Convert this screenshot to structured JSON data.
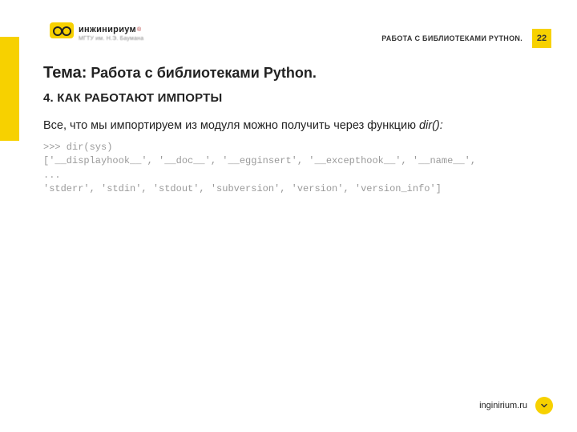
{
  "header": {
    "logo_title": "инжинириум",
    "logo_sup": "®",
    "logo_sub": "МГТУ им. Н.Э. Баумана",
    "course_title": "РАБОТА С БИБЛИОТЕКАМИ PYTHON.",
    "page_number": "22"
  },
  "topic": {
    "lead": "Тема:",
    "rest": " Работа с библиотеками Python."
  },
  "section": "4. КАК РАБОТАЮТ ИМПОРТЫ",
  "body": {
    "text_before_em": "Все, что мы импортируем из модуля можно получить через функцию ",
    "em": "dir():"
  },
  "code_lines": {
    "l1": ">>> dir(sys)",
    "l2": "['__displayhook__', '__doc__', '__egginsert', '__excepthook__', '__name__',",
    "l3": "...",
    "l4": "'stderr', 'stdin', 'stdout', 'subversion', 'version', 'version_info']"
  },
  "footer": {
    "site": "inginirium.ru"
  },
  "icons": {
    "chevron_down": "chevron-down-icon"
  },
  "colors": {
    "accent": "#f7d100",
    "text": "#222222",
    "code": "#9a9a9a"
  }
}
